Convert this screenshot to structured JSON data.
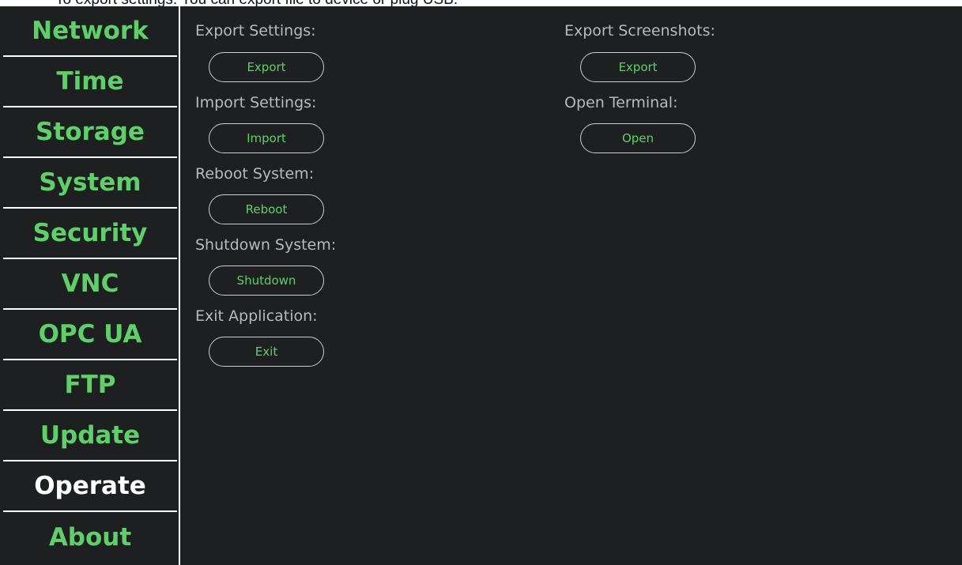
{
  "banner": {
    "text": "To export settings: You can export file to device or plug USB."
  },
  "sidebar": {
    "items": [
      {
        "label": "Network"
      },
      {
        "label": "Time"
      },
      {
        "label": "Storage"
      },
      {
        "label": "System"
      },
      {
        "label": "Security"
      },
      {
        "label": "VNC"
      },
      {
        "label": "OPC UA"
      },
      {
        "label": "FTP"
      },
      {
        "label": "Update"
      },
      {
        "label": "Operate",
        "active": true
      },
      {
        "label": "About"
      }
    ]
  },
  "operate": {
    "export_settings": {
      "label": "Export Settings:",
      "button": "Export"
    },
    "import_settings": {
      "label": "Import Settings:",
      "button": "Import"
    },
    "reboot_system": {
      "label": "Reboot System:",
      "button": "Reboot"
    },
    "shutdown_system": {
      "label": "Shutdown System:",
      "button": "Shutdown"
    },
    "exit_application": {
      "label": "Exit Application:",
      "button": "Exit"
    },
    "export_screenshots": {
      "label": "Export Screenshots:",
      "button": "Export"
    },
    "open_terminal": {
      "label": "Open Terminal:",
      "button": "Open"
    }
  },
  "colors": {
    "background": "#1e1f21",
    "accent_green": "#5fd069",
    "active_text": "#ffffff",
    "label_text": "#b7b9bc",
    "button_border": "#c9cbce"
  }
}
